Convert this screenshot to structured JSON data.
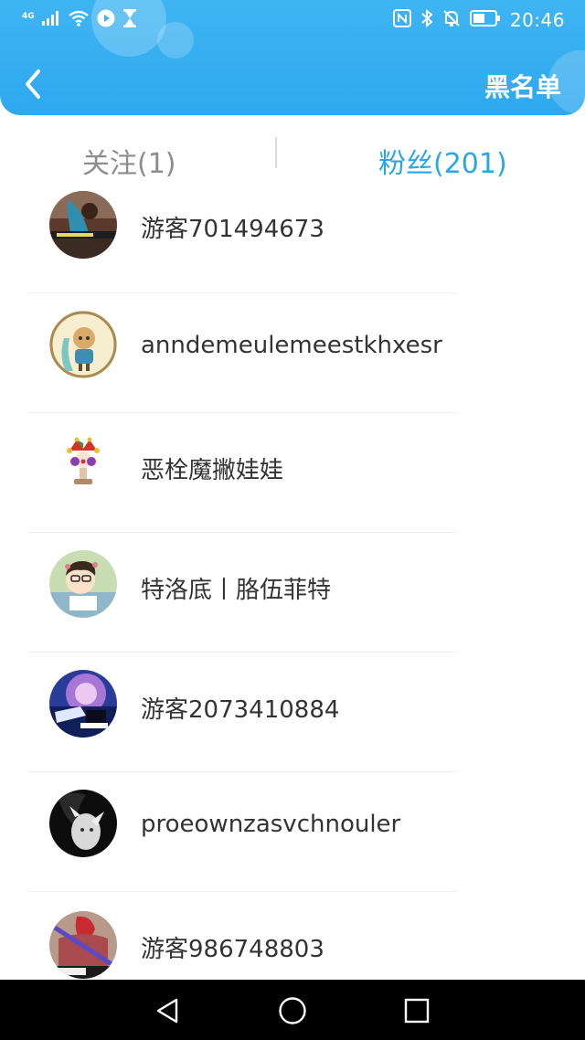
{
  "status_bar": {
    "network": "4G",
    "time": "20:46",
    "icons": [
      "signal-icon",
      "wifi-icon",
      "play-icon",
      "hourglass-icon",
      "nfc-icon",
      "bluetooth-icon",
      "mute-icon",
      "battery-icon"
    ]
  },
  "header": {
    "back_icon": "chevron-left-icon",
    "blacklist_label": "黑名单",
    "background_color": "#35aef0"
  },
  "tabs": {
    "follow_label": "关注(1)",
    "fans_label": "粉丝(201)",
    "active_color": "#2aa6e8",
    "inactive_color": "#8d8d8d",
    "active": "fans"
  },
  "fans": [
    {
      "name": "游客701494673",
      "avatar": "avatar-photo-girl-blue"
    },
    {
      "name": "anndemeulemeestkhxesr",
      "avatar": "avatar-aquarius-cartoon"
    },
    {
      "name": "恶栓魔撇娃娃",
      "avatar": "avatar-jester-clown"
    },
    {
      "name": "特洛底丨胳伍菲特",
      "avatar": "avatar-cartoon-boy-glasses"
    },
    {
      "name": "游客2073410884",
      "avatar": "avatar-night-sky-car"
    },
    {
      "name": "proeownzasvchnouler",
      "avatar": "avatar-black-white-girl"
    },
    {
      "name": "游客986748803",
      "avatar": "avatar-photo-red-dress"
    }
  ],
  "nav_bar": {
    "icons": [
      "back-triangle-icon",
      "home-circle-icon",
      "recents-square-icon"
    ]
  }
}
